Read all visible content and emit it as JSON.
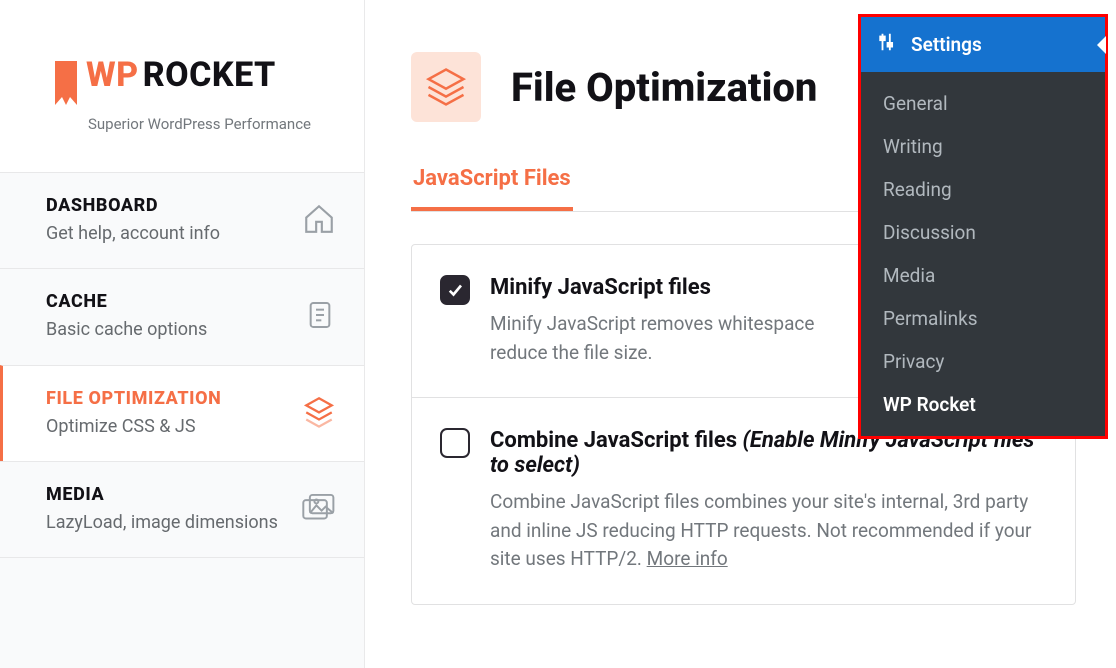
{
  "logo": {
    "wp": "WP",
    "rocket": "ROCKET",
    "subtitle": "Superior WordPress Performance"
  },
  "sidebar": {
    "items": [
      {
        "title": "DASHBOARD",
        "sub": "Get help, account info"
      },
      {
        "title": "CACHE",
        "sub": "Basic cache options"
      },
      {
        "title": "FILE OPTIMIZATION",
        "sub": "Optimize CSS & JS"
      },
      {
        "title": "MEDIA",
        "sub": "LazyLoad, image dimensions"
      }
    ]
  },
  "page": {
    "title": "File Optimization",
    "tab": "JavaScript Files"
  },
  "options": {
    "minify": {
      "title": "Minify JavaScript files",
      "desc_a": "Minify JavaScript removes whitespace",
      "desc_b": "reduce the file size."
    },
    "combine": {
      "title": "Combine JavaScript files ",
      "hint": "(Enable Minify JavaScript files to select)",
      "desc": "Combine JavaScript files combines your site's internal, 3rd party and inline JS reducing HTTP requests. Not recommended if your site uses HTTP/2. ",
      "more": "More info"
    }
  },
  "wpmenu": {
    "head": "Settings",
    "items": [
      "General",
      "Writing",
      "Reading",
      "Discussion",
      "Media",
      "Permalinks",
      "Privacy",
      "WP Rocket"
    ]
  }
}
